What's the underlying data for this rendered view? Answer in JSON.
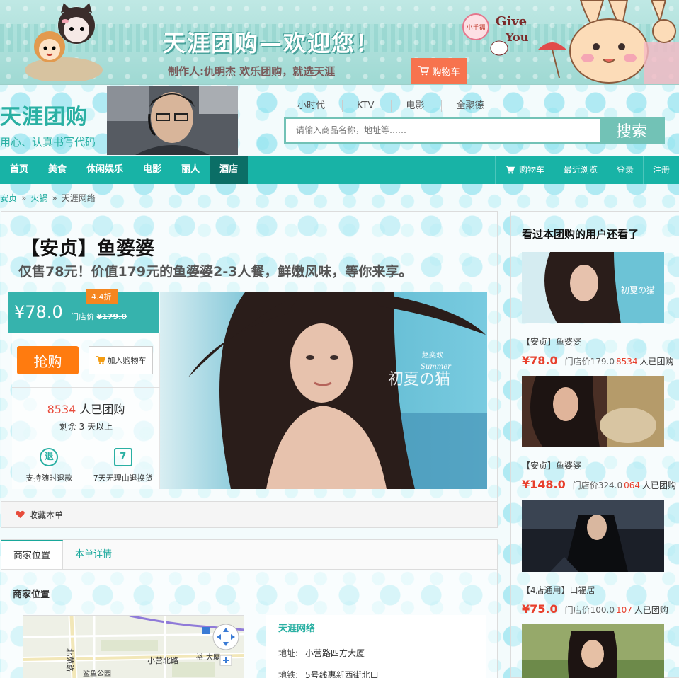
{
  "banner": {
    "title": "天涯团购—欢迎您！",
    "subtitle": "制作人:仇明杰  欢乐团购，就选天涯",
    "cart_label": "购物车",
    "give_text": "Give",
    "you_text": "You",
    "badge_text": "小手福"
  },
  "logo": {
    "name": "天涯团购",
    "slogan": "用心、认真书写代码"
  },
  "hotwords": [
    "小时代",
    "KTV",
    "电影",
    "全聚德"
  ],
  "search": {
    "placeholder": "请输入商品名称，地址等……",
    "button": "搜索"
  },
  "nav": {
    "items": [
      "首页",
      "美食",
      "休闲娱乐",
      "电影",
      "丽人",
      "酒店"
    ],
    "active": "酒店",
    "right": [
      "购物车",
      "最近浏览",
      "登录",
      "注册"
    ]
  },
  "breadcrumb": [
    "安贞",
    "火锅",
    "天涯网络"
  ],
  "deal": {
    "title": "【安贞】鱼婆婆",
    "description": "仅售78元！价值179元的鱼婆婆2-3人餐，鲜嫩风味，等你来享。",
    "price": "¥78.0",
    "original_label": "门店价",
    "original_price": "¥179.0",
    "discount": "4.4折",
    "buy_label": "抢购",
    "add_cart_label": "加入购物车",
    "sold_count": "8534",
    "sold_suffix": "人已团购",
    "remaining_prefix": "剩余",
    "remaining_value": "3",
    "remaining_suffix": "天以上",
    "guarantee_1_icon": "退",
    "guarantee_1": "支持随时退款",
    "guarantee_2_icon": "7",
    "guarantee_2": "7天无理由退换货",
    "hero_caption_top": "赵奕欢",
    "hero_caption_script": "Summer ",
    "hero_caption": "初夏の猫",
    "favorite_label": "收藏本单"
  },
  "detail": {
    "tabs": [
      "商家位置",
      "本单详情"
    ],
    "section_title": "商家位置",
    "merchant_name": "天涯网络",
    "address_label": "地址:",
    "address": "小营路四方大厦",
    "subway_label": "地铁:",
    "subway": "5号线惠新西街北口",
    "map_labels": [
      "北苑路",
      "小营北路",
      "鲨鱼公园",
      "大厦",
      "裕"
    ]
  },
  "sidebar": {
    "title": "看过本团购的用户还看了",
    "items": [
      {
        "title": "【安贞】鱼婆婆",
        "price": "¥78.0",
        "orig_label": "门店价",
        "orig": "179.0",
        "count": "8534",
        "count_label": "人已团购"
      },
      {
        "title": "【安贞】鱼婆婆",
        "price": "¥148.0",
        "orig_label": "门店价",
        "orig": "324.0",
        "count": "064",
        "count_label": "人已团购"
      },
      {
        "title": "【4店通用】口福居",
        "price": "¥75.0",
        "orig_label": "门店价",
        "orig": "100.0",
        "count": "107",
        "count_label": "人已团购"
      }
    ]
  },
  "colors": {
    "accent": "#18b3a6",
    "buy": "#ff7b0f",
    "price_red": "#e8402d",
    "cart_orange": "#f7734e"
  }
}
